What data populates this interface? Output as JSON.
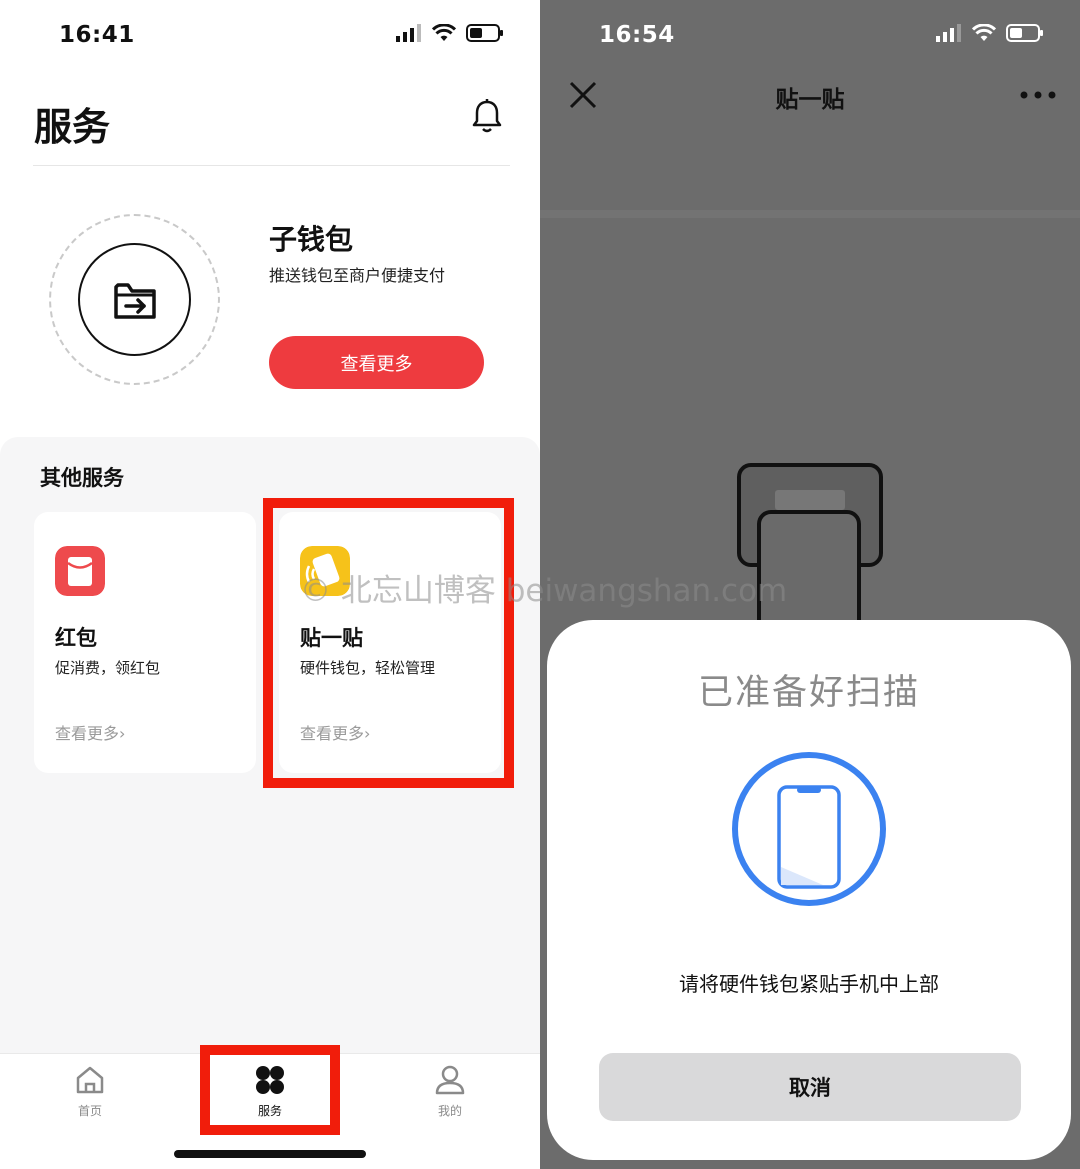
{
  "left": {
    "status_time": "16:41",
    "page_title": "服务",
    "sub_wallet": {
      "title": "子钱包",
      "desc": "推送钱包至商户便捷支付",
      "button": "查看更多"
    },
    "other_services": {
      "title": "其他服务",
      "cards": [
        {
          "title": "红包",
          "desc": "促消费，领红包",
          "more": "查看更多",
          "icon": "red-envelope-icon"
        },
        {
          "title": "贴一贴",
          "desc": "硬件钱包，轻松管理",
          "more": "查看更多",
          "icon": "tap-card-icon"
        }
      ]
    },
    "tabs": [
      {
        "label": "首页",
        "icon": "home-icon"
      },
      {
        "label": "服务",
        "icon": "services-grid-icon"
      },
      {
        "label": "我的",
        "icon": "profile-icon"
      }
    ],
    "colors": {
      "accent": "#ee3b3f",
      "highlight": "#f11d0b"
    }
  },
  "right": {
    "status_time": "16:54",
    "title": "贴一贴",
    "sheet": {
      "title": "已准备好扫描",
      "message": "请将硬件钱包紧贴手机中上部",
      "cancel": "取消"
    },
    "colors": {
      "scan_ring": "#3b82f0",
      "overlay": "#6c6c6c"
    }
  },
  "watermark": "© 北忘山博客 beiwangshan.com"
}
